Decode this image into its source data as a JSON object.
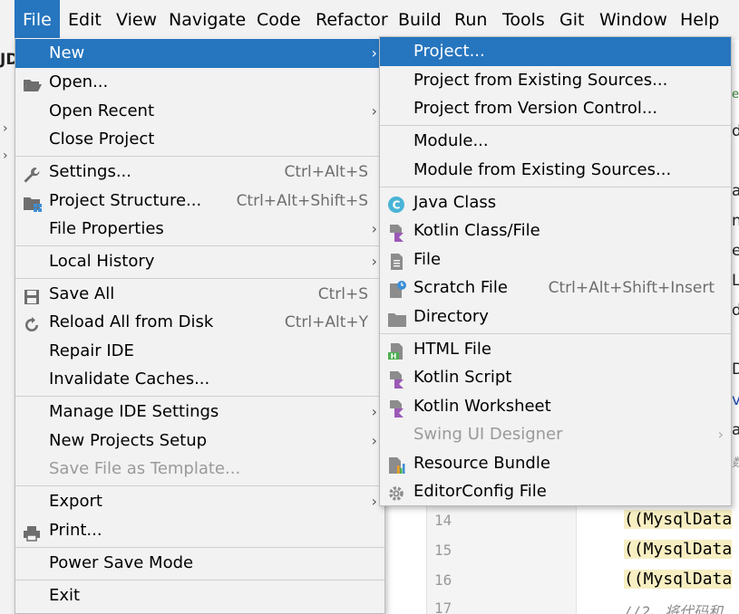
{
  "menubar": {
    "items": [
      "File",
      "Edit",
      "View",
      "Navigate",
      "Code",
      "Refactor",
      "Build",
      "Run",
      "Tools",
      "Git",
      "Window",
      "Help"
    ],
    "active": "File"
  },
  "ide": {
    "toolbar_stub": "JD",
    "right_edge_text": [
      "ele",
      "d",
      "a",
      "n",
      "e",
      "L",
      "d",
      "D",
      "v",
      "a",
      "数"
    ],
    "line_numbers": [
      "14",
      "15",
      "16",
      "17"
    ],
    "code_lines": [
      "((MysqlData",
      "((MysqlData",
      "((MysqlData",
      "//2、将代码和"
    ]
  },
  "file_menu": {
    "new": "New",
    "open": "Open...",
    "open_recent": "Open Recent",
    "close_project": "Close Project",
    "settings": "Settings...",
    "settings_sc": "Ctrl+Alt+S",
    "project_structure": "Project Structure...",
    "project_structure_sc": "Ctrl+Alt+Shift+S",
    "file_properties": "File Properties",
    "local_history": "Local History",
    "save_all": "Save All",
    "save_all_sc": "Ctrl+S",
    "reload": "Reload All from Disk",
    "reload_sc": "Ctrl+Alt+Y",
    "repair_ide": "Repair IDE",
    "invalidate_caches": "Invalidate Caches...",
    "manage_ide_settings": "Manage IDE Settings",
    "new_projects_setup": "New Projects Setup",
    "save_file_as_template": "Save File as Template...",
    "export": "Export",
    "print": "Print...",
    "power_save_mode": "Power Save Mode",
    "exit": "Exit"
  },
  "new_menu": {
    "project": "Project...",
    "project_existing": "Project from Existing Sources...",
    "project_vcs": "Project from Version Control...",
    "module": "Module...",
    "module_existing": "Module from Existing Sources...",
    "java_class": "Java Class",
    "kotlin_class": "Kotlin Class/File",
    "file": "File",
    "scratch_file": "Scratch File",
    "scratch_file_sc": "Ctrl+Alt+Shift+Insert",
    "directory": "Directory",
    "html_file": "HTML File",
    "kotlin_script": "Kotlin Script",
    "kotlin_worksheet": "Kotlin Worksheet",
    "swing_ui_designer": "Swing UI Designer",
    "resource_bundle": "Resource Bundle",
    "editorconfig_file": "EditorConfig File"
  },
  "colors": {
    "selection": "#2675bf",
    "menu_bg": "#f2f2f2",
    "shortcut": "#6e6e6e",
    "disabled": "#9a9a9a",
    "code_highlight": "#f7eec2"
  }
}
